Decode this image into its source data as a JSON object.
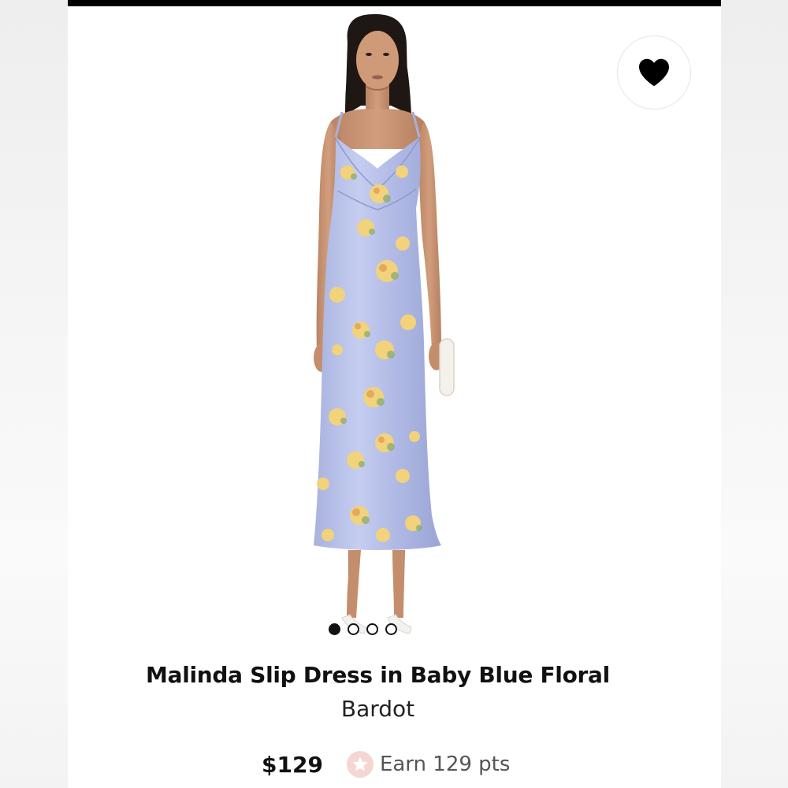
{
  "product": {
    "title": "Malinda Slip Dress in Baby Blue Floral",
    "brand": "Bardot",
    "price": "$129",
    "points_label": "Earn 129 pts",
    "image_alt": "model-wearing-blue-floral-slip-dress"
  },
  "gallery": {
    "image_count": 4,
    "active_index": 0
  },
  "icons": {
    "favorite": "heart-icon",
    "points": "star-icon"
  },
  "colors": {
    "dress": "#b4bde4",
    "points_badge": "#f6d6d3",
    "points_star": "#ffffff",
    "text_primary": "#111111",
    "text_secondary": "#555555"
  }
}
